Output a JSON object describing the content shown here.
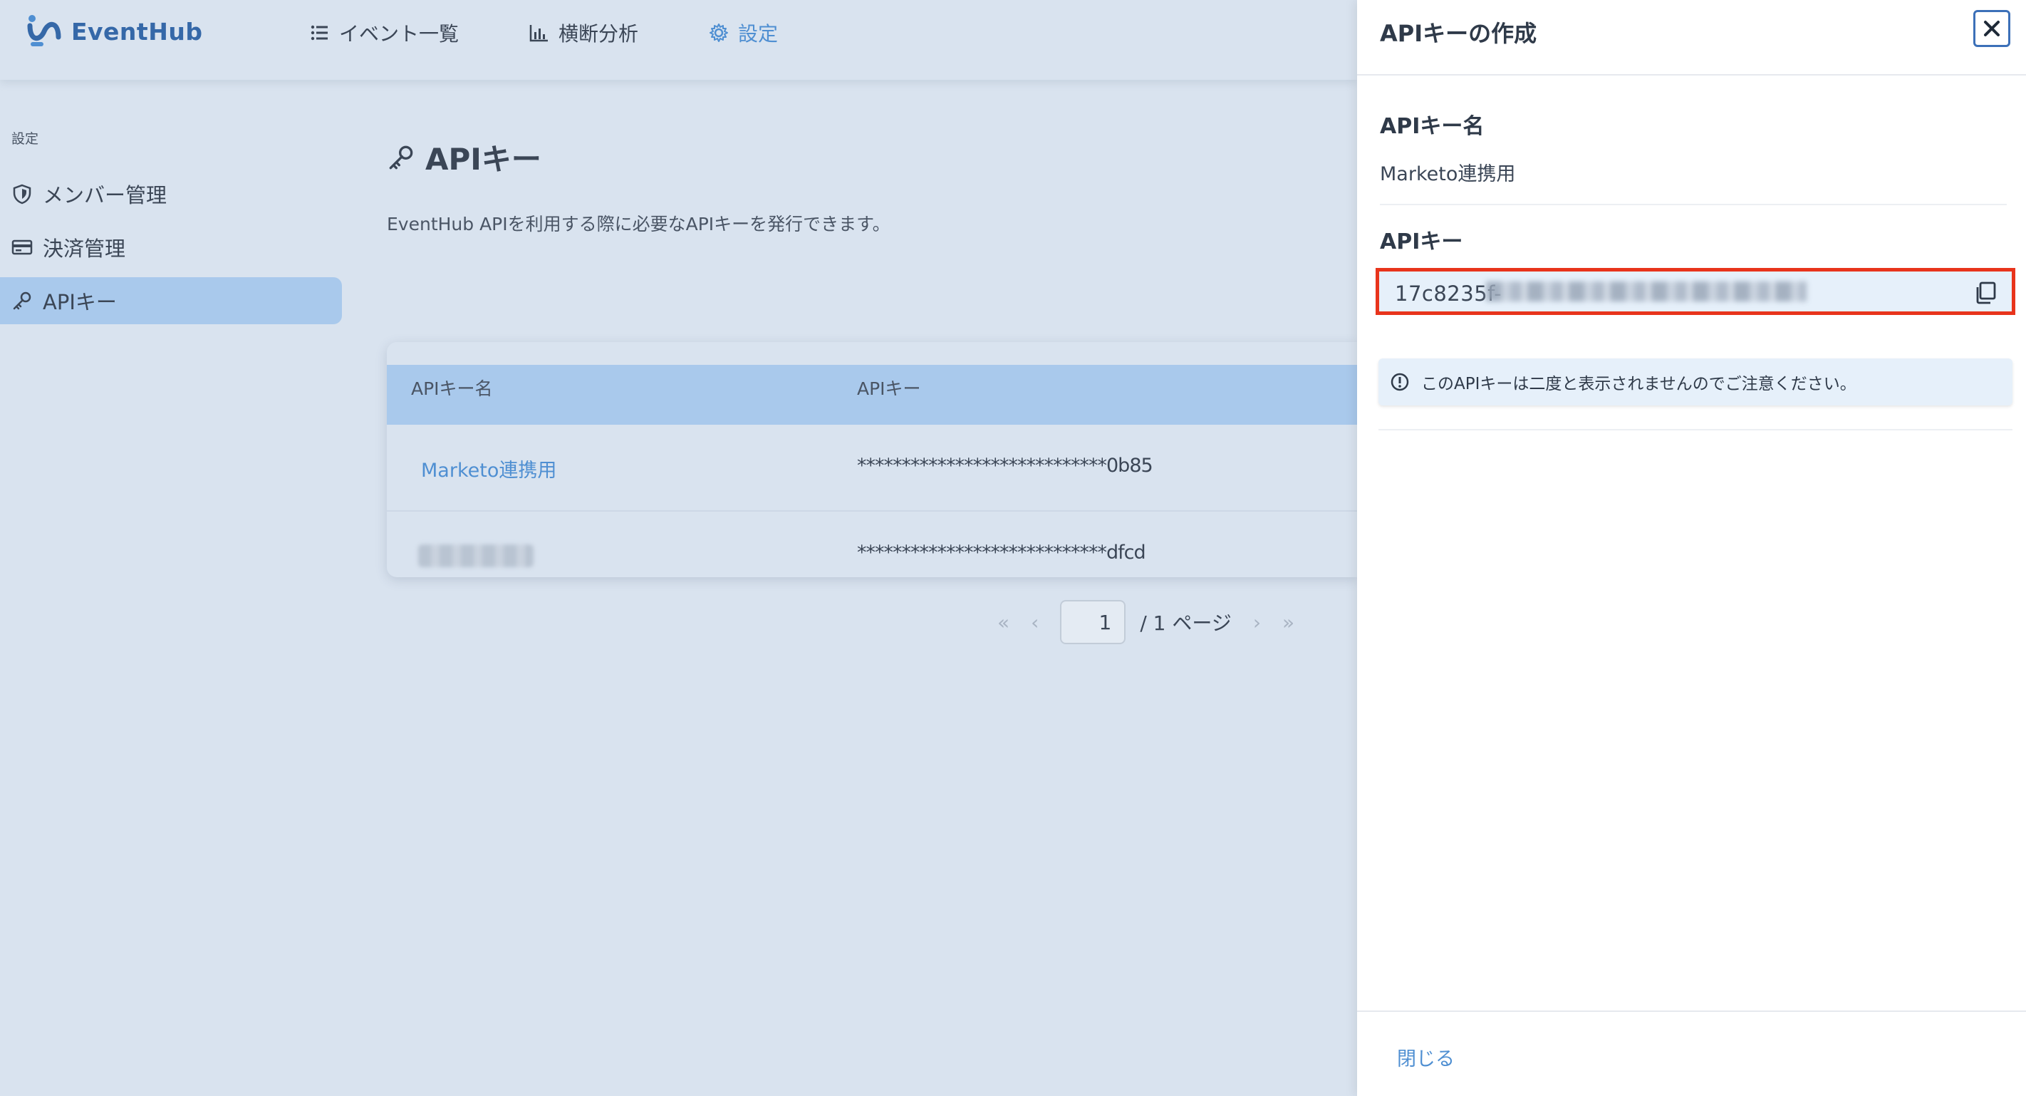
{
  "app": {
    "name": "EventHub",
    "brand_color": "#3568a8",
    "accent_color": "#4f8fd2"
  },
  "nav": {
    "items": [
      {
        "label": "イベント一覧",
        "icon": "list-icon",
        "active": false
      },
      {
        "label": "横断分析",
        "icon": "bar-chart-icon",
        "active": false
      },
      {
        "label": "設定",
        "icon": "gear-icon",
        "active": true
      }
    ]
  },
  "sidebar": {
    "heading": "設定",
    "items": [
      {
        "label": "メンバー管理",
        "icon": "shield-icon",
        "active": false
      },
      {
        "label": "決済管理",
        "icon": "credit-card-icon",
        "active": false
      },
      {
        "label": "APIキー",
        "icon": "key-icon",
        "active": true
      }
    ]
  },
  "main": {
    "title": "APIキー",
    "description": "EventHub APIを利用する際に必要なAPIキーを発行できます。",
    "table": {
      "headers": [
        "APIキー名",
        "APIキー"
      ],
      "rows": [
        {
          "name": "Marketo連携用",
          "key": "****************************0b85"
        },
        {
          "name": "",
          "key": "****************************dfcd"
        }
      ]
    },
    "pagination": {
      "current": "1",
      "suffix": "/ 1 ページ"
    }
  },
  "drawer": {
    "title": "APIキーの作成",
    "name_label": "APIキー名",
    "name_value": "Marketo連携用",
    "key_label": "APIキー",
    "key_value_visible": "17c8235f-",
    "notice": "このAPIキーは二度と表示されませんのでご注意ください。",
    "footer_close": "閉じる",
    "highlight_color": "#e8341c"
  }
}
